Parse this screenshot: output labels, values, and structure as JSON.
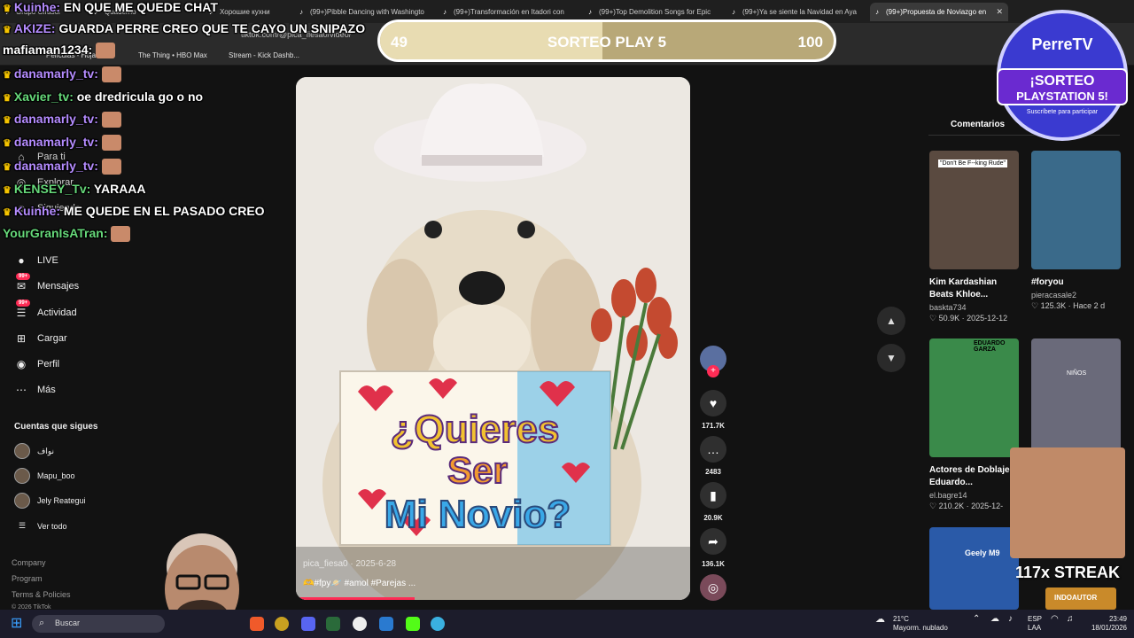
{
  "browser": {
    "tabs": [
      {
        "label": "Grupo Girasol"
      },
      {
        "label": "Quaderno"
      },
      {
        "label": "Хорошие кухни"
      },
      {
        "label": "(99+)Pibble Dancing with Washingto"
      },
      {
        "label": "(99+)Transformación en Itadori con"
      },
      {
        "label": "(99+)Top Demolition Songs for Epic"
      },
      {
        "label": "(99+)Ya se siente la Navidad en Aya"
      },
      {
        "label": "(99+)Propuesta de Noviazgo en"
      }
    ],
    "url": "tiktok.com/@pica_fiesa0/video/",
    "bookmarks": [
      "Películas - Hojas",
      "The Thing • HBO Max",
      "Stream - Kick Dashb..."
    ]
  },
  "chat": [
    {
      "user": "Kuinhe:",
      "msg": "EN QUE ME QUEDE CHAT",
      "color": "purple"
    },
    {
      "user": "AKIZE:",
      "msg": "GUARDA PERRE CREO QUE TE CAYO UN SNIPAZO",
      "color": "purple"
    },
    {
      "user": "mafiaman1234:",
      "msg": "",
      "color": "white"
    },
    {
      "user": "danamarly_tv:",
      "msg": "",
      "color": "purple"
    },
    {
      "user": "Xavier_tv:",
      "msg": "oe dredricula go o no",
      "color": "green"
    },
    {
      "user": "danamarly_tv:",
      "msg": "",
      "color": "purple"
    },
    {
      "user": "danamarly_tv:",
      "msg": "",
      "color": "purple"
    },
    {
      "user": "danamarly_tv:",
      "msg": "",
      "color": "purple"
    },
    {
      "user": "KENSEY_Tv:",
      "msg": "YARAAA",
      "color": "green"
    },
    {
      "user": "Kuinhe:",
      "msg": "ME QUEDE EN EL PASADO CREO",
      "color": "purple"
    },
    {
      "user": "YourGranIsATran:",
      "msg": "",
      "color": "green"
    }
  ],
  "sidebar": {
    "nav_hidden": [
      "Para ti",
      "Explorar",
      "Siguiendo"
    ],
    "nav": [
      {
        "label": "LIVE",
        "icon": "live-icon"
      },
      {
        "label": "Mensajes",
        "icon": "messages-icon",
        "badge": "99+"
      },
      {
        "label": "Actividad",
        "icon": "activity-icon",
        "badge": "99+"
      },
      {
        "label": "Cargar",
        "icon": "upload-icon"
      },
      {
        "label": "Perfil",
        "icon": "profile-icon"
      },
      {
        "label": "Más",
        "icon": "more-icon"
      }
    ],
    "following_title": "Cuentas que sigues",
    "following": [
      "نواف",
      "Mapu_boo",
      "Jely Reategui"
    ],
    "see_all": "Ver todo",
    "footer": [
      "Company",
      "Program",
      "Terms & Policies",
      "© 2026 TikTok"
    ]
  },
  "giveaway": {
    "left": "49",
    "title": "SORTEO PLAY 5",
    "right": "100",
    "progress": 0.49
  },
  "video": {
    "author_date": "pica_fiesa0 · 2025-6-28",
    "tags": "🫶#fpy🪐 #amol #Parejas ...",
    "sign_text": [
      "¿Quieres",
      "Ser",
      "Mi Novio?"
    ],
    "progress": 0.3
  },
  "actions": [
    {
      "icon": "heart-icon",
      "count": "171.7K"
    },
    {
      "icon": "comment-icon",
      "count": "2483"
    },
    {
      "icon": "bookmark-icon",
      "count": "20.9K"
    },
    {
      "icon": "share-icon",
      "count": "136.1K"
    }
  ],
  "right": {
    "tab": "Comentarios",
    "cards": [
      {
        "title": "Kim Kardashian Beats Khloe...",
        "author": "baskta734",
        "stats": "♡ 50.9K · 2025-12-12",
        "thumb_caption": "\"Don't Be F--king Rude\""
      },
      {
        "title": "#foryou",
        "author": "pieracasale2",
        "stats": "♡ 125.3K · Hace 2 d",
        "thumb_caption": ""
      },
      {
        "title": "Actores de Doblaje: Eduardo...",
        "author": "el.bagre14",
        "stats": "♡ 210.2K · 2025-12-",
        "thumb_caption": "EDUARDO GARZA"
      },
      {
        "title": "",
        "author": "",
        "stats": "",
        "thumb_caption": "NIÑOS"
      },
      {
        "title": "",
        "author": "",
        "stats": "",
        "thumb_caption": "Geely M9"
      },
      {
        "title": "",
        "author": "",
        "stats": "",
        "thumb_caption": "INDOAUTOR"
      }
    ]
  },
  "logo": {
    "brand": "PerreTV",
    "line1": "¡SORTEO",
    "line2": "PLAYSTATION 5!",
    "line3": "Suscríbete para participar"
  },
  "streak": "117x STREAK",
  "taskbar": {
    "search": "Buscar",
    "weather_temp": "21°C",
    "weather_desc": "Mayorm. nublado",
    "lang1": "ESP",
    "lang2": "LAA",
    "time": "23:49",
    "date": "18/01/2026"
  }
}
